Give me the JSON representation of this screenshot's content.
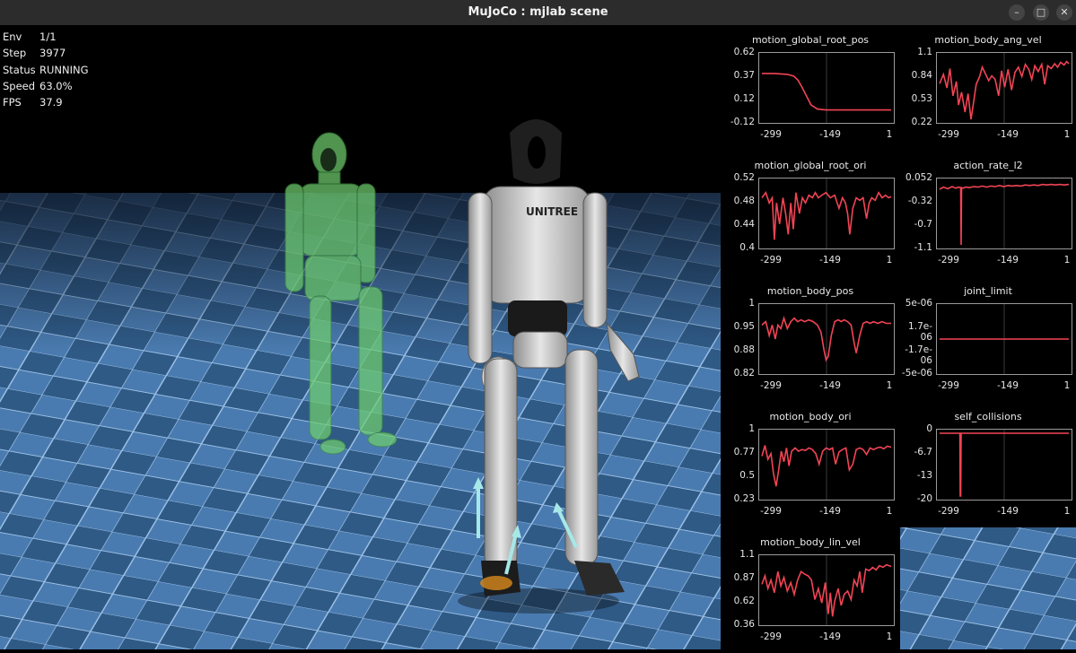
{
  "window": {
    "title": "MuJoCo : mjlab scene"
  },
  "stats": [
    {
      "key": "Env",
      "value": "1/1"
    },
    {
      "key": "Step",
      "value": "3977"
    },
    {
      "key": "Status",
      "value": "RUNNING"
    },
    {
      "key": "Speed",
      "value": "63.0%"
    },
    {
      "key": "FPS",
      "value": "37.9"
    }
  ],
  "robot_brand": "UNITREE",
  "colors": {
    "plot_line": "#f24455",
    "floor": "#355f8e",
    "ghost": "#6fce6f"
  },
  "chart_data": [
    {
      "id": "motion_global_root_pos",
      "type": "line",
      "title": "motion_global_root_pos",
      "yticks": [
        "0.62",
        "0.37",
        "0.12",
        "-0.12"
      ],
      "ylim": [
        -0.12,
        0.62
      ],
      "xticks": [
        "-299",
        "-149",
        "1"
      ],
      "xlim": [
        -299,
        1
      ],
      "series": [
        {
          "x": [
            -299,
            -270,
            -240,
            -225,
            -215,
            -205,
            -195,
            -185,
            -170,
            -150,
            -100,
            -50,
            1
          ],
          "y": [
            0.42,
            0.42,
            0.41,
            0.39,
            0.34,
            0.25,
            0.15,
            0.05,
            0.0,
            -0.01,
            -0.01,
            -0.01,
            -0.01
          ]
        }
      ]
    },
    {
      "id": "motion_body_ang_vel",
      "type": "line",
      "title": "motion_body_ang_vel",
      "yticks": [
        "1.1",
        "0.84",
        "0.53",
        "0.22"
      ],
      "ylim": [
        0.22,
        1.1
      ],
      "xticks": [
        "-299",
        "-149",
        "1"
      ],
      "xlim": [
        -299,
        1
      ],
      "series": [
        {
          "x": [
            -299,
            -290,
            -282,
            -275,
            -268,
            -260,
            -255,
            -248,
            -240,
            -233,
            -226,
            -220,
            -214,
            -206,
            -200,
            -192,
            -185,
            -178,
            -170,
            -162,
            -155,
            -148,
            -140,
            -132,
            -124,
            -116,
            -108,
            -100,
            -92,
            -85,
            -78,
            -70,
            -62,
            -55,
            -48,
            -40,
            -32,
            -25,
            -18,
            -10,
            -4,
            1
          ],
          "y": [
            0.72,
            0.85,
            0.66,
            0.93,
            0.55,
            0.75,
            0.42,
            0.6,
            0.32,
            0.58,
            0.22,
            0.46,
            0.71,
            0.82,
            0.95,
            0.85,
            0.76,
            0.83,
            0.78,
            0.55,
            0.9,
            0.67,
            0.92,
            0.63,
            0.88,
            0.95,
            0.82,
            0.99,
            0.92,
            0.78,
            0.97,
            0.89,
            0.99,
            0.71,
            0.97,
            0.93,
            1.0,
            0.95,
            1.02,
            0.98,
            1.03,
            1.0
          ]
        }
      ]
    },
    {
      "id": "motion_global_root_ori",
      "type": "line",
      "title": "motion_global_root_ori",
      "yticks": [
        "0.52",
        "0.48",
        "0.44",
        "0.4"
      ],
      "ylim": [
        0.4,
        0.52
      ],
      "xticks": [
        "-299",
        "-149",
        "1"
      ],
      "xlim": [
        -299,
        1
      ],
      "series": [
        {
          "x": [
            -299,
            -290,
            -282,
            -275,
            -270,
            -265,
            -258,
            -250,
            -244,
            -238,
            -232,
            -226,
            -220,
            -212,
            -205,
            -198,
            -190,
            -182,
            -175,
            -168,
            -160,
            -150,
            -140,
            -130,
            -120,
            -112,
            -105,
            -100,
            -95,
            -88,
            -80,
            -72,
            -64,
            -56,
            -50,
            -44,
            -36,
            -28,
            -20,
            -12,
            -5,
            1
          ],
          "y": [
            0.49,
            0.5,
            0.48,
            0.49,
            0.41,
            0.48,
            0.44,
            0.49,
            0.46,
            0.42,
            0.48,
            0.43,
            0.5,
            0.46,
            0.49,
            0.48,
            0.495,
            0.49,
            0.5,
            0.49,
            0.495,
            0.5,
            0.49,
            0.495,
            0.47,
            0.49,
            0.48,
            0.46,
            0.42,
            0.47,
            0.49,
            0.485,
            0.49,
            0.45,
            0.48,
            0.49,
            0.485,
            0.5,
            0.49,
            0.495,
            0.49,
            0.492
          ]
        }
      ]
    },
    {
      "id": "action_rate_l2",
      "type": "line",
      "title": "action_rate_l2",
      "yticks": [
        "0.052",
        "-0.32",
        "-0.7",
        "-1.1"
      ],
      "ylim": [
        -1.1,
        0.052
      ],
      "xticks": [
        "-299",
        "-149",
        "1"
      ],
      "xlim": [
        -299,
        1
      ],
      "series": [
        {
          "x": [
            -299,
            -290,
            -280,
            -270,
            -262,
            -255,
            -250,
            -249,
            -248,
            -245,
            -238,
            -230,
            -220,
            -210,
            -200,
            -190,
            -180,
            -170,
            -160,
            -150,
            -140,
            -130,
            -120,
            -110,
            -100,
            -90,
            -80,
            -70,
            -60,
            -50,
            -40,
            -30,
            -20,
            -10,
            1
          ],
          "y": [
            -0.08,
            -0.04,
            -0.07,
            -0.03,
            -0.06,
            -0.04,
            -0.05,
            -1.1,
            -0.05,
            -0.06,
            -0.04,
            -0.05,
            -0.03,
            -0.04,
            -0.02,
            -0.04,
            -0.02,
            -0.03,
            -0.01,
            -0.03,
            -0.01,
            -0.02,
            -0.01,
            -0.02,
            0.0,
            -0.01,
            0.0,
            -0.01,
            0.01,
            0.0,
            0.01,
            0.0,
            0.01,
            0.0,
            0.01
          ]
        }
      ]
    },
    {
      "id": "motion_body_pos",
      "type": "line",
      "title": "motion_body_pos",
      "yticks": [
        "1",
        "0.95",
        "0.88",
        "0.82"
      ],
      "ylim": [
        0.82,
        1.0
      ],
      "xticks": [
        "-299",
        "-149",
        "1"
      ],
      "xlim": [
        -299,
        1
      ],
      "series": [
        {
          "x": [
            -299,
            -290,
            -282,
            -275,
            -268,
            -262,
            -255,
            -248,
            -240,
            -232,
            -224,
            -216,
            -208,
            -200,
            -190,
            -180,
            -170,
            -162,
            -155,
            -150,
            -145,
            -138,
            -130,
            -122,
            -115,
            -108,
            -100,
            -92,
            -85,
            -80,
            -72,
            -64,
            -56,
            -48,
            -40,
            -30,
            -20,
            -10,
            1
          ],
          "y": [
            0.95,
            0.96,
            0.92,
            0.95,
            0.91,
            0.95,
            0.94,
            0.97,
            0.94,
            0.96,
            0.97,
            0.96,
            0.965,
            0.96,
            0.965,
            0.96,
            0.95,
            0.93,
            0.88,
            0.85,
            0.86,
            0.92,
            0.96,
            0.965,
            0.96,
            0.965,
            0.96,
            0.95,
            0.9,
            0.87,
            0.92,
            0.955,
            0.96,
            0.955,
            0.96,
            0.955,
            0.96,
            0.955,
            0.955
          ]
        }
      ]
    },
    {
      "id": "joint_limit",
      "type": "line",
      "title": "joint_limit",
      "yticks": [
        "5e-06",
        "1.7e-06",
        "-1.7e-06",
        "-5e-06"
      ],
      "ylim": [
        -5e-06,
        5e-06
      ],
      "xticks": [
        "-299",
        "-149",
        "1"
      ],
      "xlim": [
        -299,
        1
      ],
      "series": [
        {
          "x": [
            -299,
            1
          ],
          "y": [
            0,
            0
          ]
        }
      ]
    },
    {
      "id": "motion_body_ori",
      "type": "line",
      "title": "motion_body_ori",
      "yticks": [
        "1",
        "0.77",
        "0.5",
        "0.23"
      ],
      "ylim": [
        0.23,
        1.0
      ],
      "xticks": [
        "-299",
        "-149",
        "1"
      ],
      "xlim": [
        -299,
        1
      ],
      "series": [
        {
          "x": [
            -299,
            -292,
            -285,
            -278,
            -272,
            -266,
            -260,
            -254,
            -248,
            -242,
            -236,
            -230,
            -222,
            -214,
            -206,
            -198,
            -190,
            -182,
            -174,
            -166,
            -158,
            -150,
            -142,
            -135,
            -128,
            -120,
            -112,
            -104,
            -96,
            -88,
            -80,
            -72,
            -64,
            -56,
            -48,
            -40,
            -32,
            -24,
            -16,
            -8,
            1
          ],
          "y": [
            0.72,
            0.85,
            0.68,
            0.75,
            0.5,
            0.35,
            0.55,
            0.78,
            0.65,
            0.82,
            0.6,
            0.78,
            0.82,
            0.78,
            0.8,
            0.79,
            0.82,
            0.8,
            0.75,
            0.62,
            0.78,
            0.82,
            0.8,
            0.82,
            0.62,
            0.77,
            0.8,
            0.82,
            0.55,
            0.62,
            0.8,
            0.82,
            0.8,
            0.74,
            0.82,
            0.8,
            0.82,
            0.83,
            0.81,
            0.84,
            0.83
          ]
        }
      ]
    },
    {
      "id": "self_collisions",
      "type": "line",
      "title": "self_collisions",
      "yticks": [
        "0",
        "-6.7",
        "-13",
        "-20"
      ],
      "ylim": [
        -20,
        0
      ],
      "xticks": [
        "-299",
        "-149",
        "1"
      ],
      "xlim": [
        -299,
        1
      ],
      "series": [
        {
          "x": [
            -299,
            -252,
            -251,
            -250,
            -249,
            1
          ],
          "y": [
            0,
            0,
            -20,
            -20,
            0,
            0
          ]
        }
      ]
    },
    {
      "id": "motion_body_lin_vel",
      "type": "line",
      "title": "motion_body_lin_vel",
      "yticks": [
        "1.1",
        "0.87",
        "0.62",
        "0.36"
      ],
      "ylim": [
        0.36,
        1.1
      ],
      "xticks": [
        "-299",
        "-149",
        "1"
      ],
      "xlim": [
        -299,
        1
      ],
      "series": [
        {
          "x": [
            -299,
            -292,
            -285,
            -278,
            -270,
            -262,
            -255,
            -248,
            -240,
            -232,
            -224,
            -216,
            -208,
            -200,
            -192,
            -184,
            -176,
            -168,
            -160,
            -152,
            -145,
            -140,
            -135,
            -130,
            -122,
            -115,
            -108,
            -100,
            -92,
            -85,
            -78,
            -72,
            -66,
            -58,
            -50,
            -42,
            -34,
            -26,
            -18,
            -10,
            1
          ],
          "y": [
            0.8,
            0.9,
            0.75,
            0.85,
            0.7,
            0.95,
            0.78,
            0.88,
            0.72,
            0.82,
            0.68,
            0.85,
            0.95,
            0.92,
            0.9,
            0.85,
            0.62,
            0.75,
            0.58,
            0.82,
            0.45,
            0.7,
            0.42,
            0.6,
            0.75,
            0.55,
            0.68,
            0.72,
            0.62,
            0.85,
            0.78,
            0.95,
            0.7,
            0.98,
            0.96,
            1.0,
            0.97,
            1.02,
            1.0,
            1.03,
            1.01
          ]
        }
      ]
    }
  ]
}
